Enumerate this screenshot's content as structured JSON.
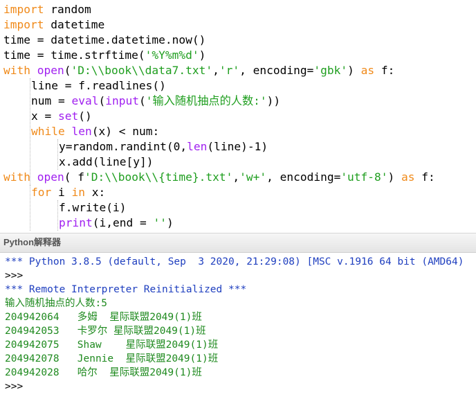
{
  "editor": {
    "lines": [
      {
        "indent": 0,
        "tokens": [
          {
            "t": "import",
            "c": "kw"
          },
          {
            "t": " random",
            "c": ""
          }
        ]
      },
      {
        "indent": 0,
        "tokens": [
          {
            "t": "import",
            "c": "kw"
          },
          {
            "t": " datetime",
            "c": ""
          }
        ]
      },
      {
        "indent": 0,
        "tokens": [
          {
            "t": "time = datetime.datetime.now()",
            "c": ""
          }
        ]
      },
      {
        "indent": 0,
        "tokens": [
          {
            "t": "time = time.strftime(",
            "c": ""
          },
          {
            "t": "'%Y%m%d'",
            "c": "str"
          },
          {
            "t": ")",
            "c": ""
          }
        ]
      },
      {
        "indent": 0,
        "tokens": [
          {
            "t": "with",
            "c": "kw"
          },
          {
            "t": " ",
            "c": ""
          },
          {
            "t": "open",
            "c": "bi"
          },
          {
            "t": "(",
            "c": ""
          },
          {
            "t": "'D:\\\\book\\\\data7.txt'",
            "c": "str"
          },
          {
            "t": ",",
            "c": ""
          },
          {
            "t": "'r'",
            "c": "str"
          },
          {
            "t": ", encoding=",
            "c": ""
          },
          {
            "t": "'gbk'",
            "c": "str"
          },
          {
            "t": ") ",
            "c": ""
          },
          {
            "t": "as",
            "c": "kw"
          },
          {
            "t": " f:",
            "c": ""
          }
        ]
      },
      {
        "indent": 1,
        "tokens": [
          {
            "t": "line = f.readlines()",
            "c": ""
          }
        ]
      },
      {
        "indent": 1,
        "tokens": [
          {
            "t": "num = ",
            "c": ""
          },
          {
            "t": "eval",
            "c": "bi"
          },
          {
            "t": "(",
            "c": ""
          },
          {
            "t": "input",
            "c": "bi"
          },
          {
            "t": "(",
            "c": ""
          },
          {
            "t": "'输入随机抽点的人数:'",
            "c": "str"
          },
          {
            "t": "))",
            "c": ""
          }
        ]
      },
      {
        "indent": 1,
        "tokens": [
          {
            "t": "x = ",
            "c": ""
          },
          {
            "t": "set",
            "c": "bi"
          },
          {
            "t": "()",
            "c": ""
          }
        ]
      },
      {
        "indent": 1,
        "tokens": [
          {
            "t": "while",
            "c": "kw"
          },
          {
            "t": " ",
            "c": ""
          },
          {
            "t": "len",
            "c": "bi"
          },
          {
            "t": "(x) < num:",
            "c": ""
          }
        ]
      },
      {
        "indent": 2,
        "tokens": [
          {
            "t": "y=random.randint(0,",
            "c": ""
          },
          {
            "t": "len",
            "c": "bi"
          },
          {
            "t": "(line)-1)",
            "c": ""
          }
        ]
      },
      {
        "indent": 2,
        "tokens": [
          {
            "t": "x.add(line[y])",
            "c": ""
          }
        ]
      },
      {
        "indent": 0,
        "tokens": [
          {
            "t": "with",
            "c": "kw"
          },
          {
            "t": " ",
            "c": ""
          },
          {
            "t": "open",
            "c": "bi"
          },
          {
            "t": "( f",
            "c": ""
          },
          {
            "t": "'D:\\\\book\\\\{time}.txt'",
            "c": "str"
          },
          {
            "t": ",",
            "c": ""
          },
          {
            "t": "'w+'",
            "c": "str"
          },
          {
            "t": ", encoding=",
            "c": ""
          },
          {
            "t": "'utf-8'",
            "c": "str"
          },
          {
            "t": ") ",
            "c": ""
          },
          {
            "t": "as",
            "c": "kw"
          },
          {
            "t": " f:",
            "c": ""
          }
        ]
      },
      {
        "indent": 1,
        "tokens": [
          {
            "t": "for",
            "c": "kw"
          },
          {
            "t": " i ",
            "c": ""
          },
          {
            "t": "in",
            "c": "kw"
          },
          {
            "t": " x:",
            "c": ""
          }
        ]
      },
      {
        "indent": 2,
        "tokens": [
          {
            "t": "f.write(i)",
            "c": ""
          }
        ]
      },
      {
        "indent": 2,
        "tokens": [
          {
            "t": "print",
            "c": "bi"
          },
          {
            "t": "(i,end = ",
            "c": ""
          },
          {
            "t": "''",
            "c": "str"
          },
          {
            "t": ")",
            "c": ""
          }
        ]
      }
    ]
  },
  "shell": {
    "title": "Python解释器",
    "lines": [
      {
        "text": "*** Python 3.8.5 (default, Sep  3 2020, 21:29:08) [MSC v.1916 64 bit (AMD64)",
        "kind": "info"
      },
      {
        "text": ">>>",
        "kind": "prompt"
      },
      {
        "text": "*** Remote Interpreter Reinitialized ***",
        "kind": "info"
      },
      {
        "text": "输入随机抽点的人数:5",
        "kind": "result"
      },
      {
        "text": "204942064   多姆  星际联盟2049(1)班",
        "kind": "result"
      },
      {
        "text": "204942053   卡罗尔 星际联盟2049(1)班",
        "kind": "result"
      },
      {
        "text": "204942075   Shaw    星际联盟2049(1)班",
        "kind": "result"
      },
      {
        "text": "204942078   Jennie  星际联盟2049(1)班",
        "kind": "result"
      },
      {
        "text": "204942028   哈尔  星际联盟2049(1)班",
        "kind": "result"
      },
      {
        "text": ">>>",
        "kind": "prompt"
      }
    ]
  }
}
